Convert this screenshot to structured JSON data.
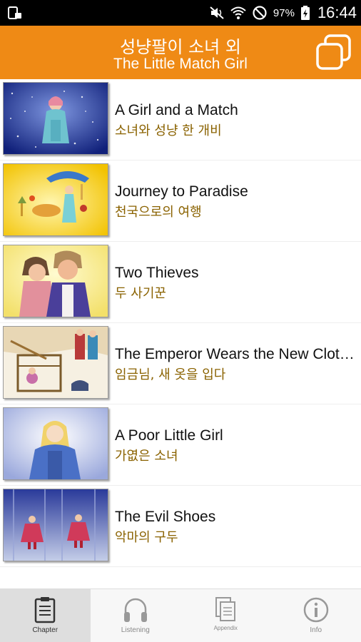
{
  "status_bar": {
    "battery_percent": "97%",
    "time": "16:44",
    "icons": [
      "notification-icon",
      "mute-icon",
      "wifi-icon",
      "block-icon",
      "battery-charging-icon"
    ]
  },
  "header": {
    "title_ko": "성냥팔이 소녀 외",
    "title_en": "The Little Match Girl",
    "accent_color": "#ef8a15"
  },
  "chapters": [
    {
      "title_en": "A Girl and a Match",
      "title_ko": "소녀와 성냥 한 개비"
    },
    {
      "title_en": "Journey to Paradise",
      "title_ko": "천국으로의 여행"
    },
    {
      "title_en": "Two Thieves",
      "title_ko": "두 사기꾼"
    },
    {
      "title_en": "The Emperor Wears the New Clothes",
      "title_ko": "임금님, 새 옷을 입다"
    },
    {
      "title_en": "A Poor Little Girl",
      "title_ko": "가엾은 소녀"
    },
    {
      "title_en": "The Evil Shoes",
      "title_ko": "악마의 구두"
    }
  ],
  "bottom_nav": [
    {
      "label": "Chapter",
      "icon": "clipboard-icon",
      "active": true
    },
    {
      "label": "Listening",
      "icon": "headphones-icon",
      "active": false
    },
    {
      "label": "Appendix",
      "icon": "documents-icon",
      "active": false
    },
    {
      "label": "Info",
      "icon": "info-icon",
      "active": false
    }
  ]
}
